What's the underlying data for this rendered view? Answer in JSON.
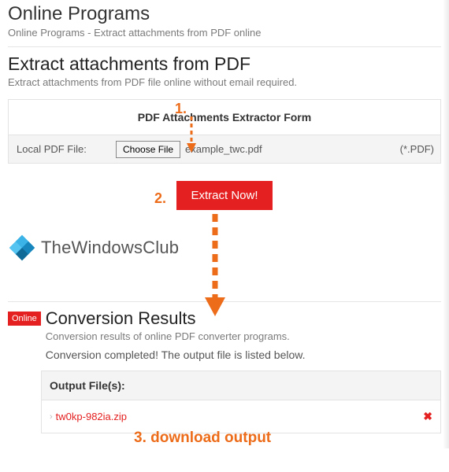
{
  "header": {
    "title": "Online Programs",
    "subtitle": "Online Programs - Extract attachments from PDF online"
  },
  "section": {
    "title": "Extract attachments from PDF",
    "desc": "Extract attachments from PDF file online without email required."
  },
  "form": {
    "heading": "PDF Attachments Extractor Form",
    "label": "Local PDF File:",
    "choose_label": "Choose File",
    "filename": "example_twc.pdf",
    "ext_hint": "(*.PDF)"
  },
  "action": {
    "extract_label": "Extract Now!"
  },
  "watermark": {
    "text": "TheWindowsClub"
  },
  "results": {
    "tag": "Online",
    "title": "Conversion Results",
    "desc": "Conversion results of online PDF converter programs.",
    "status": "Conversion completed! The output file is listed below.",
    "output_heading": "Output File(s):",
    "output_file": "tw0kp-982ia.zip",
    "delete_glyph": "✖"
  },
  "annotations": {
    "step1": "1.",
    "step2": "2.",
    "step3": "3. download output"
  }
}
